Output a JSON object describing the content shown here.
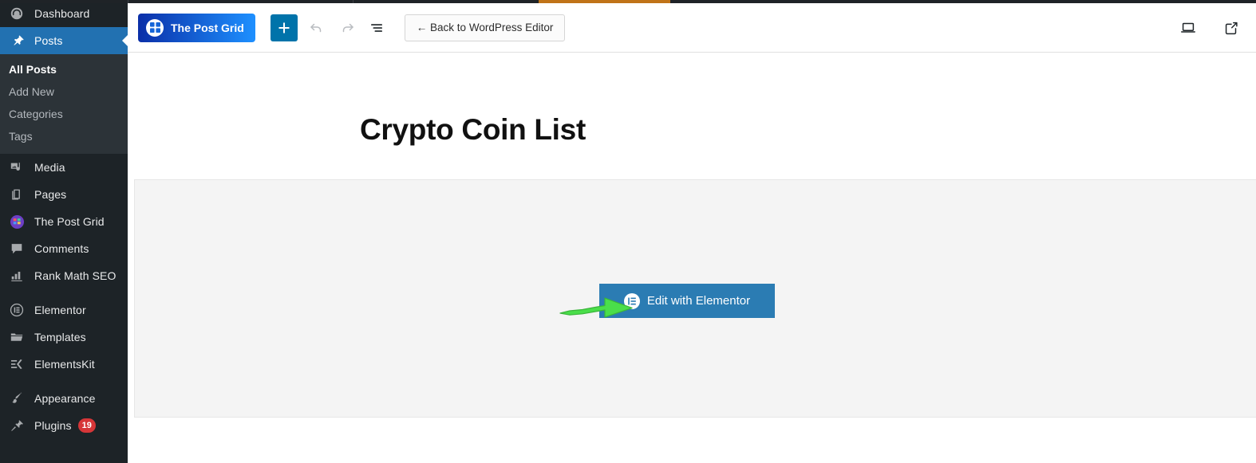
{
  "colors": {
    "sidebar_bg": "#1d2327",
    "submenu_bg": "#2c3338",
    "active_blue": "#2271b1",
    "badge_red": "#d63638",
    "brand_blue": "#1565d8",
    "elementor_blue": "#2b7cb3",
    "arrow_green": "#4ade4a",
    "progress_orange": "#c07318",
    "block_bg": "#f4f4f4"
  },
  "sidebar": {
    "items": [
      {
        "label": "Dashboard",
        "icon": "dashboard-icon",
        "active": false
      },
      {
        "label": "Posts",
        "icon": "pin-icon",
        "active": true
      },
      {
        "label": "Media",
        "icon": "media-icon",
        "active": false
      },
      {
        "label": "Pages",
        "icon": "pages-icon",
        "active": false
      },
      {
        "label": "The Post Grid",
        "icon": "post-grid-icon",
        "active": false
      },
      {
        "label": "Comments",
        "icon": "comments-icon",
        "active": false
      },
      {
        "label": "Rank Math SEO",
        "icon": "rank-math-icon",
        "active": false
      },
      {
        "label": "Elementor",
        "icon": "elementor-icon",
        "active": false
      },
      {
        "label": "Templates",
        "icon": "folder-icon",
        "active": false
      },
      {
        "label": "ElementsKit",
        "icon": "elementskit-icon",
        "active": false
      },
      {
        "label": "Appearance",
        "icon": "brush-icon",
        "active": false
      },
      {
        "label": "Plugins",
        "icon": "plugin-icon",
        "active": false,
        "badge": "19"
      }
    ],
    "submenu": [
      {
        "label": "All Posts",
        "current": true
      },
      {
        "label": "Add New",
        "current": false
      },
      {
        "label": "Categories",
        "current": false
      },
      {
        "label": "Tags",
        "current": false
      }
    ]
  },
  "toolbar": {
    "brand_label": "The Post Grid",
    "add_block_label": "+",
    "back_label": "← Back to WordPress Editor",
    "undo_name": "undo",
    "redo_name": "redo",
    "list_view_name": "list-view",
    "view_device_name": "desktop-preview",
    "open_new_tab_name": "view-site"
  },
  "canvas": {
    "page_title": "Crypto Coin List",
    "elementor_button_label": "Edit with Elementor"
  }
}
